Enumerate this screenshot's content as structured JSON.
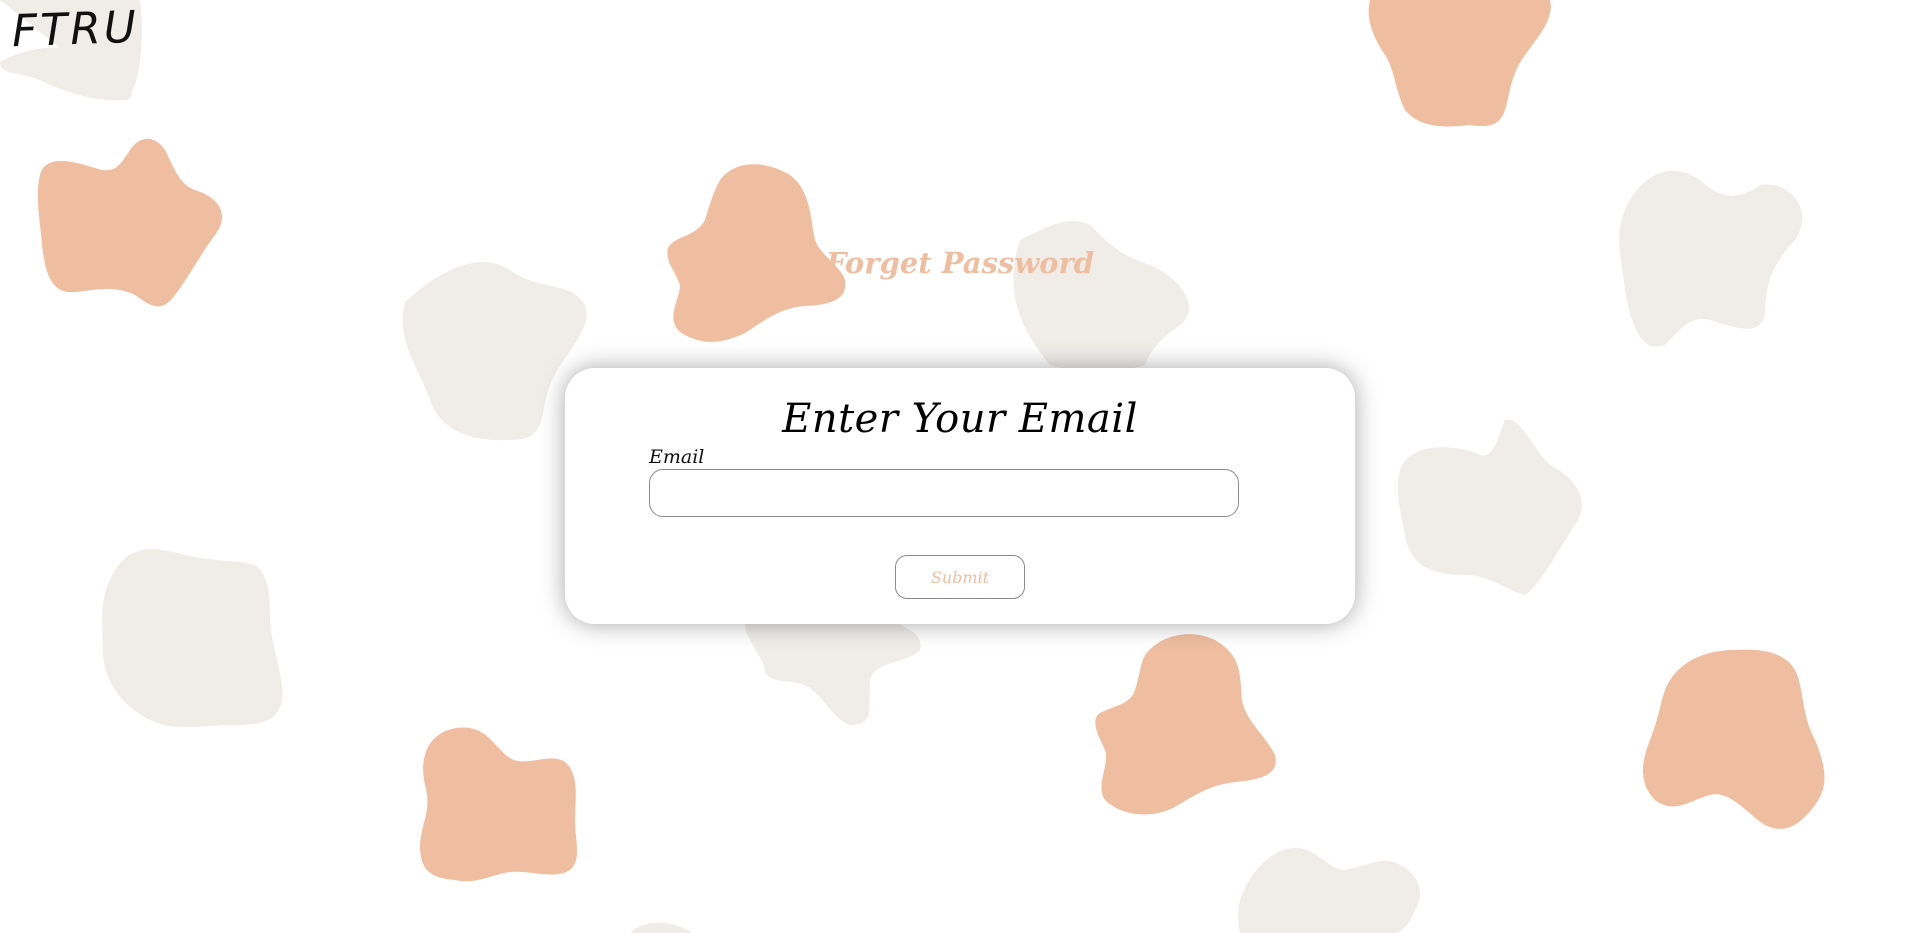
{
  "brand": {
    "logo_text": "FTRU"
  },
  "page": {
    "heading": "Forget Password"
  },
  "card": {
    "title": "Enter Your Email",
    "email_label": "Email",
    "email_value": "",
    "email_placeholder": "",
    "submit_label": "Submit"
  },
  "colors": {
    "peach_blob": "#efbda0",
    "gray_blob": "#f0ede9",
    "accent_text": "#efbda0",
    "background": "#ffffff"
  }
}
